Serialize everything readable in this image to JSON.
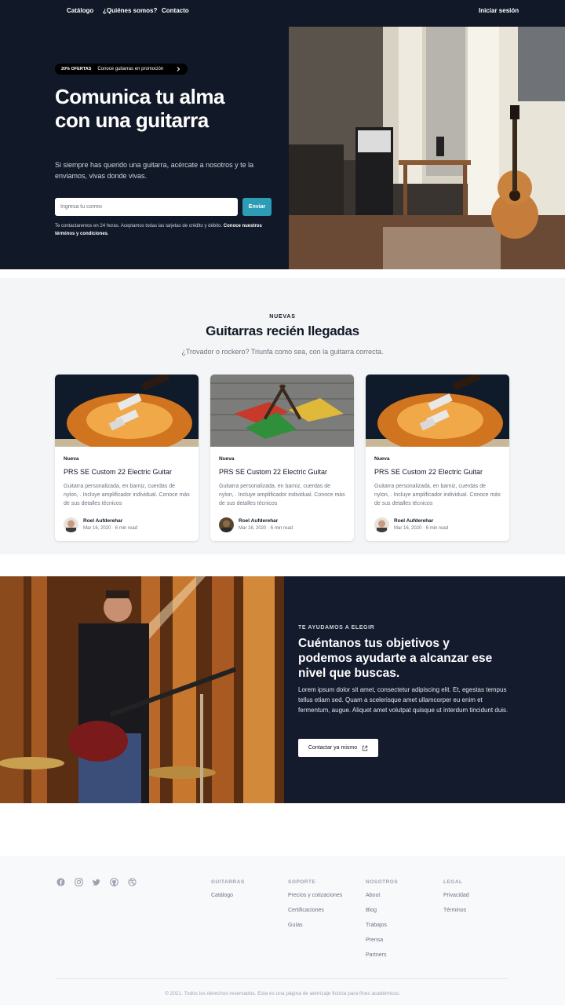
{
  "nav": {
    "links": [
      "Catálogo",
      "¿Quiénes somos?",
      "Contacto"
    ],
    "login": "Iniciar sesión"
  },
  "hero": {
    "badge_strong": "20% OFERTAS",
    "badge_text": "Conoce guitarras en promoción",
    "title_line1": "Comunica tu alma",
    "title_line2": "con una guitarra",
    "subtitle": "Si siempre has querido una guitarra, acércate a nosotros y te la enviamos, vivas donde vivas.",
    "email_placeholder": "Ingresa tu correo",
    "send_label": "Enviar",
    "disclaimer_text": "Te contactaremos en 24 horas. Aceptamos todas las tarjetas de crédito y débito. ",
    "disclaimer_link": "Conoce nuestros términos y condiciones",
    "disclaimer_end": "."
  },
  "arrivals": {
    "eyebrow": "NUEVAS",
    "title": "Guitarras recién llegadas",
    "subtitle": "¿Trovador o rockero? Triunfa como sea, con la guitarra correcta.",
    "cards": [
      {
        "tag": "Nueva",
        "title": "PRS SE Custom 22 Electric Guitar",
        "description": "Guitarra personalizada, en barniz, cuerdas de nylon, . Incluye amplificador individual. Conoce más de sus detalles técnicos",
        "author": "Roel Aufderehar",
        "meta": "Mar 16, 2020 · 6 min read"
      },
      {
        "tag": "Nueva",
        "title": "PRS SE Custom 22 Electric Guitar",
        "description": "Guitarra personalizada, en barniz, cuerdas de nylon, . Incluye amplificador individual. Conoce más de sus detalles técnicos",
        "author": "Roel Aufderehar",
        "meta": "Mar 16, 2020 · 6 min read"
      },
      {
        "tag": "Nueva",
        "title": "PRS SE Custom 22 Electric Guitar",
        "description": "Guitarra personalizada, en barniz, cuerdas de nylon, . Incluye amplificador individual. Conoce más de sus detalles técnicos",
        "author": "Roel Aufderehar",
        "meta": "Mar 16, 2020 · 6 min read"
      }
    ]
  },
  "help": {
    "eyebrow": "TE AYUDAMOS A ELEGIR",
    "title_line1": "Cuéntanos tus objetivos y",
    "title_line2": "podemos ayudarte a alcanzar ese",
    "title_line3": "nivel que buscas.",
    "body": "Lorem ipsum dolor sit amet, consectetur adipiscing elit. Et, egestas tempus tellus etiam sed. Quam a scelerisque amet ullamcorper eu enim et fermentum, augue. Aliquet amet volutpat quisque ut interdum tincidunt duis.",
    "button": "Contactar ya mismo"
  },
  "footer": {
    "social_icons": [
      "facebook-icon",
      "instagram-icon",
      "twitter-icon",
      "github-icon",
      "dribbble-icon"
    ],
    "columns": [
      {
        "heading": "GUITARRAS",
        "links": [
          "Catálogo"
        ]
      },
      {
        "heading": "SOPORTE",
        "links": [
          "Precios y cotizaciones",
          "Certificaciones",
          "Guías"
        ]
      },
      {
        "heading": "NOSOTROS",
        "links": [
          "About",
          "Blog",
          "Trabajos",
          "Prensa",
          "Partners"
        ]
      },
      {
        "heading": "LEGAL",
        "links": [
          "Privacidad",
          "Términos"
        ]
      }
    ],
    "copyright": "© 2021. Todos los derechos reservados. Esta es una página de aterrizaje ficticia para fines académicos."
  },
  "colors": {
    "dark_bg": "#111827",
    "accent": "#2d9cb5",
    "section_bg": "#f4f5f7"
  }
}
